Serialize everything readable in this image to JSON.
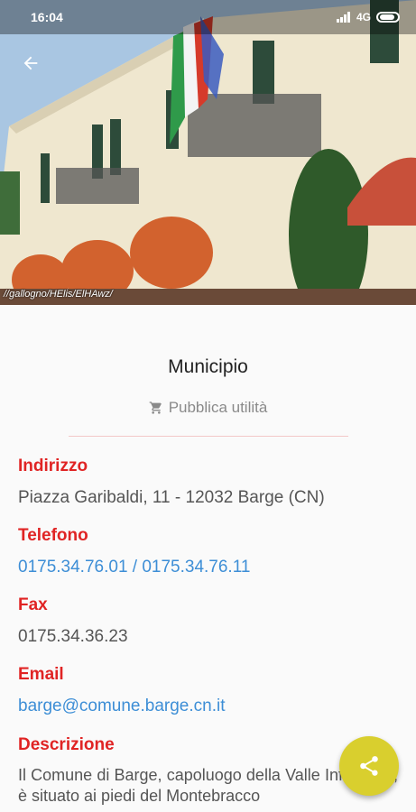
{
  "status_bar": {
    "time": "16:04",
    "network": "4G"
  },
  "hero": {
    "credit": "//gallogno/HElis/ElHAwz/"
  },
  "place": {
    "title": "Municipio",
    "category": "Pubblica utilità"
  },
  "fields": {
    "address_label": "Indirizzo",
    "address_value": "Piazza Garibaldi, 11 - 12032 Barge (CN)",
    "phone_label": "Telefono",
    "phone_value": "0175.34.76.01 / 0175.34.76.11",
    "fax_label": "Fax",
    "fax_value": "0175.34.36.23",
    "email_label": "Email",
    "email_value": "barge@comune.barge.cn.it",
    "description_label": "Descrizione",
    "description_value": "Il Comune di Barge, capoluogo della Valle Infernotto, è situato ai piedi del Montebracco"
  },
  "colors": {
    "accent_red": "#e02424",
    "link_blue": "#3d8ed6",
    "fab_yellow": "#d9cf2e"
  },
  "icons": {
    "back": "arrow-left-icon",
    "category": "cart-icon",
    "share": "share-icon"
  }
}
